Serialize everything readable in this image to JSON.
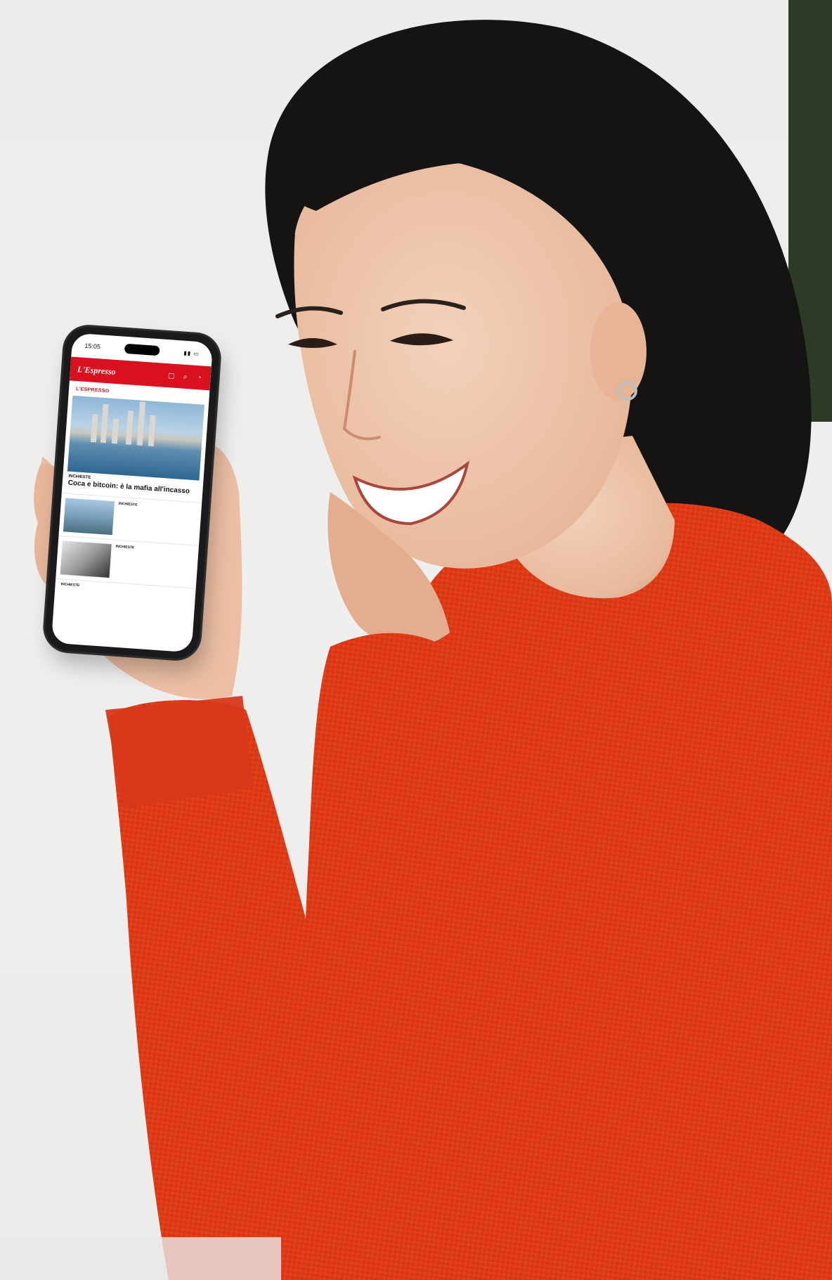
{
  "phone": {
    "status_time": "15:05",
    "app_logo": "L'Espresso",
    "section_label": "L'ESPRESSO",
    "hero": {
      "kicker": "INCHIESTE",
      "headline": "Coca e bitcoin: è la mafia all'incasso"
    },
    "items": [
      {
        "kicker": "INCHIESTE",
        "title": ""
      },
      {
        "kicker": "INCHIESTE",
        "title": ""
      }
    ],
    "bottom": {
      "kicker": "INCHIESTE",
      "title": ""
    }
  },
  "colors": {
    "brand_red": "#d8101f",
    "sweater": "#e43a16",
    "hair": "#141312",
    "background": "#ececea"
  }
}
